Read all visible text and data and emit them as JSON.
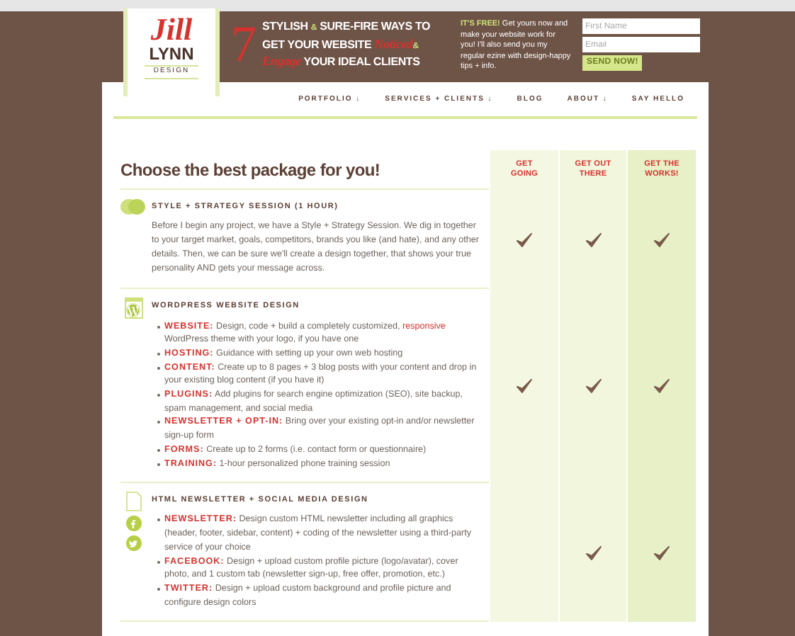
{
  "logo": {
    "script": "Jill",
    "name": "LYNN",
    "tagline": "DESIGN"
  },
  "promo": {
    "number": "7",
    "headline": [
      {
        "kind": "plain",
        "text": "STYLISH "
      },
      {
        "kind": "amp",
        "text": "&"
      },
      {
        "kind": "plain",
        "text": " SURE-FIRE WAYS TO GET YOUR WEBSITE "
      },
      {
        "kind": "script",
        "text": "Noticed"
      },
      {
        "kind": "amp",
        "text": "&"
      },
      {
        "kind": "script",
        "text": " Engage"
      },
      {
        "kind": "plain",
        "text": " YOUR IDEAL CLIENTS"
      }
    ],
    "lead": "IT'S FREE!",
    "text": " Get yours now and make your website work for you! I'll also send you my regular ezine with design-happy tips + info."
  },
  "form": {
    "fields": [
      {
        "placeholder": "First Name"
      },
      {
        "placeholder": "Email"
      }
    ],
    "button": "SEND NOW!"
  },
  "nav": [
    "PORTFOLIO ↓",
    "SERVICES + CLIENTS ↓",
    "BLOG",
    "ABOUT ↓",
    "SAY HELLO"
  ],
  "table": {
    "heading": "Choose the best package for you!",
    "columns": [
      {
        "lines": [
          "GET",
          "GOING"
        ]
      },
      {
        "lines": [
          "GET OUT",
          "THERE"
        ]
      },
      {
        "lines": [
          "GET THE",
          "WORKS!"
        ]
      }
    ],
    "rows": [
      {
        "title": "STYLE + STRATEGY SESSION (1 HOUR)",
        "kind": "paragraph",
        "text": "Before I begin any project, we have a Style + Strategy Session. We dig in together to your target market, goals, competitors, brands you like (and hate), and any other details. Then, we can be sure we'll create a design together, that shows your true personality AND gets your message across.",
        "checks": [
          true,
          true,
          true
        ]
      },
      {
        "title": "WORDPRESS WEBSITE DESIGN",
        "kind": "list",
        "bullets": [
          {
            "label": "WEBSITE:",
            "parts": [
              {
                "kind": "plain",
                "text": " Design, code + build a completely customized, "
              },
              {
                "kind": "accent",
                "text": "responsive"
              },
              {
                "kind": "plain",
                "text": " WordPress theme with your logo, if you have one"
              }
            ]
          },
          {
            "label": "HOSTING:",
            "parts": [
              {
                "kind": "plain",
                "text": " Guidance with setting up your own web hosting"
              }
            ]
          },
          {
            "label": "CONTENT:",
            "parts": [
              {
                "kind": "plain",
                "text": " Create up to 8 pages + 3 blog posts with your content and drop in your existing blog content (if you have it)"
              }
            ]
          },
          {
            "label": "PLUGINS:",
            "parts": [
              {
                "kind": "plain",
                "text": " Add plugins for search engine optimization (SEO), site backup, spam management, and social media"
              }
            ]
          },
          {
            "label": "NEWSLETTER + OPT-IN:",
            "parts": [
              {
                "kind": "plain",
                "text": " Bring over your existing opt-in and/or newsletter sign-up form"
              }
            ]
          },
          {
            "label": "FORMS:",
            "parts": [
              {
                "kind": "plain",
                "text": " Create up to 2 forms (i.e. contact form or questionnaire)"
              }
            ]
          },
          {
            "label": "TRAINING:",
            "parts": [
              {
                "kind": "plain",
                "text": " 1-hour personalized phone training session"
              }
            ]
          }
        ],
        "checks": [
          true,
          true,
          true
        ]
      },
      {
        "title": "HTML NEWSLETTER + SOCIAL MEDIA DESIGN",
        "kind": "list",
        "bullets": [
          {
            "label": "NEWSLETTER:",
            "parts": [
              {
                "kind": "plain",
                "text": " Design custom HTML newsletter including all graphics (header, footer, sidebar, content) + coding of the newsletter using a third-party service of your choice"
              }
            ]
          },
          {
            "label": "FACEBOOK:",
            "parts": [
              {
                "kind": "plain",
                "text": " Design + upload custom profile picture (logo/avatar), cover photo, and 1 custom tab (newsletter sign-up, free offer, promotion, etc.)"
              }
            ]
          },
          {
            "label": "TWITTER:",
            "parts": [
              {
                "kind": "plain",
                "text": " Design + upload custom background and profile picture and configure design colors"
              }
            ]
          }
        ],
        "checks": [
          false,
          true,
          true
        ]
      }
    ]
  }
}
